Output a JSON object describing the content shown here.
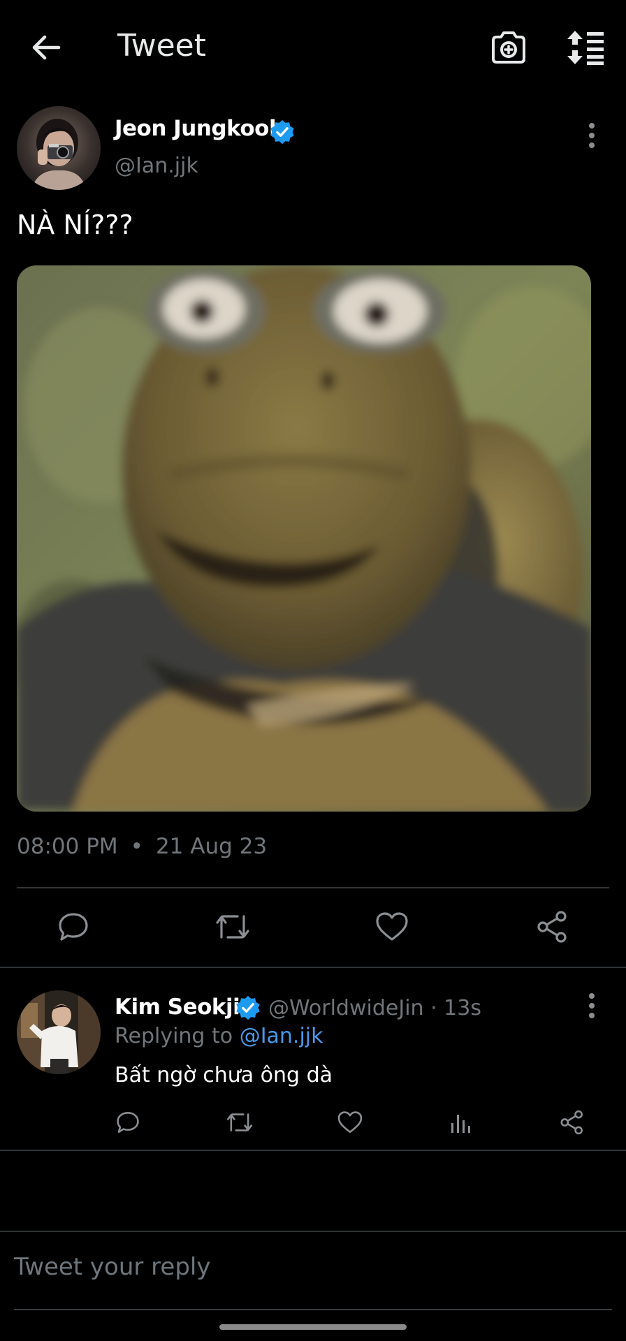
{
  "header": {
    "title": "Tweet",
    "back_icon": "arrow-left-icon",
    "camera_icon": "camera-plus-icon",
    "sort_icon": "sort-list-icon"
  },
  "tweet": {
    "author_name": "Jeon Jungkook",
    "author_handle": "@Ian.jjk",
    "text": "NÀ NÍ???",
    "time": "08:00 PM",
    "separator": "•",
    "date": "21 Aug 23",
    "actions": [
      "reply-icon",
      "retweet-icon",
      "like-icon",
      "share-icon"
    ]
  },
  "reply": {
    "author_name": "Kim Seokjin",
    "meta": "@WorldwideJin · 13s",
    "replying_prefix": "Replying to",
    "replying_handle": "@Ian.jjk",
    "text": "Bất ngờ chưa ông dà",
    "actions": [
      "reply-icon",
      "retweet-icon",
      "like-icon",
      "analytics-icon",
      "share-icon"
    ]
  },
  "compose": {
    "placeholder": "Tweet your reply"
  },
  "colors": {
    "background": "#000000",
    "text": "#e7e9ea",
    "muted": "#71767b",
    "accent": "#1d9bf0",
    "link": "#4a99e9",
    "divider": "#2f3336"
  }
}
